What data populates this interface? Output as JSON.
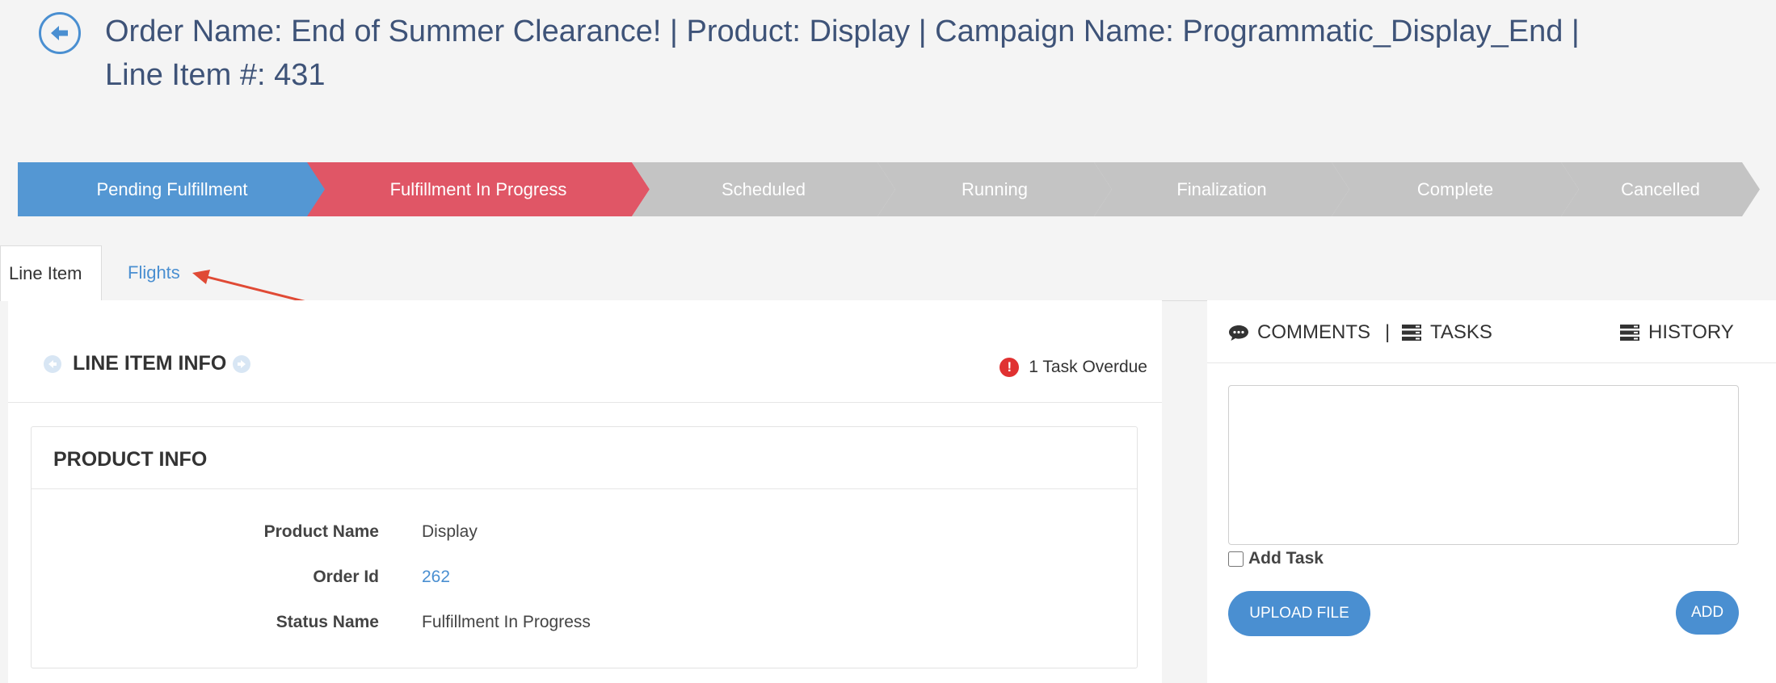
{
  "header": {
    "title": "Order Name: End of Summer Clearance! | Product: Display | Campaign Name: Programmatic_Display_End | Line Item #: 431"
  },
  "stages": [
    {
      "label": "Pending Fulfillment",
      "color": "#5497d3"
    },
    {
      "label": "Fulfillment In Progress",
      "color": "#e05666"
    },
    {
      "label": "Scheduled",
      "color": "#c4c4c4"
    },
    {
      "label": "Running",
      "color": "#c4c4c4"
    },
    {
      "label": "Finalization",
      "color": "#c4c4c4"
    },
    {
      "label": "Complete",
      "color": "#c4c4c4"
    },
    {
      "label": "Cancelled",
      "color": "#c4c4c4"
    }
  ],
  "tabs": {
    "line_item": "Line Item",
    "flights": "Flights"
  },
  "line_item_info": {
    "title": "LINE ITEM INFO",
    "overdue_text": "1 Task Overdue"
  },
  "product_info": {
    "title": "PRODUCT INFO",
    "fields": [
      {
        "label": "Product Name",
        "value": "Display"
      },
      {
        "label": "Order Id",
        "value": "262"
      },
      {
        "label": "Status Name",
        "value": "Fulfillment In Progress"
      }
    ]
  },
  "side_panel": {
    "comments": "COMMENTS",
    "divider": "|",
    "tasks": "TASKS",
    "history": "HISTORY",
    "comment_placeholder": "",
    "add_task": "Add Task",
    "upload_label": "UPLOAD FILE",
    "add_label": "ADD"
  },
  "colors": {
    "accent": "#4a8fd1",
    "alert": "#e03131",
    "annotation_arrow": "#e04a35"
  }
}
